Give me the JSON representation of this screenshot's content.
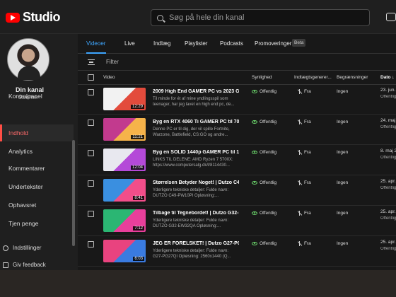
{
  "app": {
    "logo_text": "Studio"
  },
  "search": {
    "placeholder": "Søg på hele din kanal"
  },
  "channel": {
    "title": "Din kanal",
    "name": "SteelTek"
  },
  "sidebar": {
    "items": [
      {
        "label": "Kontrolpanel"
      },
      {
        "label": "Indhold"
      },
      {
        "label": "Analytics"
      },
      {
        "label": "Kommentarer"
      },
      {
        "label": "Undertekster"
      },
      {
        "label": "Ophavsret"
      },
      {
        "label": "Tjen penge"
      }
    ],
    "bottom": [
      {
        "label": "Indstillinger"
      },
      {
        "label": "Giv feedback"
      }
    ]
  },
  "tabs": [
    "Videoer",
    "Live",
    "Indlæg",
    "Playlister",
    "Podcasts",
    "Promoveringer"
  ],
  "beta_label": "Beta",
  "filter": {
    "label": "Filter"
  },
  "columns": {
    "video": "Video",
    "visibility": "Synlighed",
    "restrictions": "Indtægtsgenerer...",
    "limits": "Begrænsninger",
    "date": "Dato ↓"
  },
  "rows": [
    {
      "title": "2009 High End GAMER PC vs 2023 GA...",
      "desc": "Til minde for ét af mine yndlingsspil som teenager, har jeg lavet en high end pc, de...",
      "duration": "12:29",
      "visibility": "Offentlig",
      "monetization": "Fra",
      "restrictions": "Ingen",
      "date": "23. jun. 2...",
      "date_sub": "Offentliggjort",
      "thumb_colors": [
        "#f2f2f2",
        "#e34b3c"
      ]
    },
    {
      "title": "Byg en RTX 4060 Ti GAMER PC til 700...",
      "desc": "Denne PC er til dig, der vil spille Fortnite, Warzone, Battlefield, CS:GO og andre...",
      "duration": "11:21",
      "visibility": "Offentlig",
      "monetization": "Fra",
      "restrictions": "Ingen",
      "date": "24. maj 2...",
      "date_sub": "Offentliggjort",
      "thumb_colors": [
        "#c23a8e",
        "#f6b34a"
      ]
    },
    {
      "title": "Byg en SOLID 1440p GAMER PC til 10...",
      "desc": "LINKS TIL DELENE: AMD Ryzen 7 5700X: https://www.computersalg.dk/l/8114430...",
      "duration": "12:04",
      "visibility": "Offentlig",
      "monetization": "Fra",
      "restrictions": "Ingen",
      "date": "8. maj 20...",
      "date_sub": "Offentliggjort",
      "thumb_colors": [
        "#e8e8ef",
        "#b44ad8"
      ]
    },
    {
      "title": "Størrelsen Betyder Noget! | Dutzo C49-...",
      "desc": "Yderligere tekniske detaljer: Fulde navn: DUTZO C49-PW10PI Opløsning:...",
      "duration": "8:41",
      "visibility": "Offentlig",
      "monetization": "Fra",
      "restrictions": "Ingen",
      "date": "25. apr. 2...",
      "date_sub": "Offentliggjort",
      "thumb_colors": [
        "#3a8fe0",
        "#f24e8a"
      ]
    },
    {
      "title": "Tilbage til Tegnebordet! | Dutzo G32-E...",
      "desc": "Yderligere tekniske detaljer: Fulde navn: DUTZO G32-EW32QA Opløsning:...",
      "duration": "7:12",
      "visibility": "Offentlig",
      "monetization": "Fra",
      "restrictions": "Ingen",
      "date": "25. apr. 2...",
      "date_sub": "Offentliggjort",
      "thumb_colors": [
        "#2bb673",
        "#e83f9b"
      ]
    },
    {
      "title": "JEG ER FORELSKET! | Dutzo G27-PG27...",
      "desc": "Yderligere tekniske detaljer: Fulde navn: G27-PG27QI Opløsning: 2560x1440 (Q...",
      "duration": "6:03",
      "visibility": "Offentlig",
      "monetization": "Fra",
      "restrictions": "Ingen",
      "date": "25. apr. 2...",
      "date_sub": "Offentliggjort",
      "thumb_colors": [
        "#e9437f",
        "#3a7be0"
      ]
    }
  ]
}
